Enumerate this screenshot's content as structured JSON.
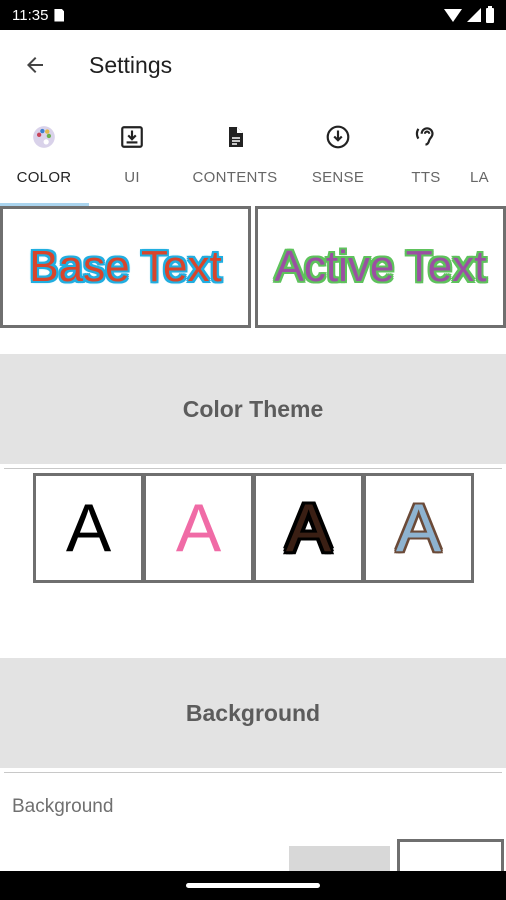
{
  "status_bar": {
    "time": "11:35"
  },
  "app_bar": {
    "title": "Settings"
  },
  "tabs": [
    {
      "label": "COLOR",
      "icon": "palette-icon",
      "active": true
    },
    {
      "label": "UI",
      "icon": "download-box-icon"
    },
    {
      "label": "CONTENTS",
      "icon": "document-icon"
    },
    {
      "label": "SENSE",
      "icon": "arrow-circle-down-icon"
    },
    {
      "label": "TTS",
      "icon": "hearing-icon"
    },
    {
      "label": "LA",
      "icon": ""
    }
  ],
  "preview": {
    "base_text": "Base Text",
    "active_text": "Active Text"
  },
  "color_theme": {
    "title": "Color Theme",
    "options": [
      "A",
      "A",
      "A",
      "A"
    ]
  },
  "background_section": {
    "title": "Background",
    "label": "Background"
  },
  "colors": {
    "accent_indicator": "#aad4ee",
    "base_fill": "#d9442a",
    "base_outline": "#22aee0",
    "active_fill": "#9b4fa3",
    "active_outline": "#5ec25c",
    "section_bg": "#e3e3e3"
  }
}
